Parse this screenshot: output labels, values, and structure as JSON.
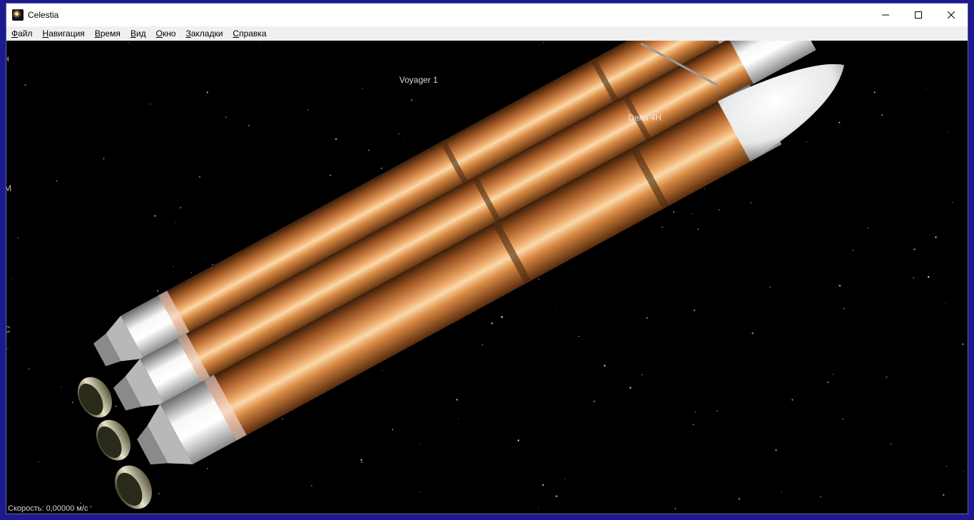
{
  "window": {
    "title": "Celestia",
    "controls": {
      "minimize": "minimize-icon",
      "maximize": "maximize-icon",
      "close": "close-icon"
    }
  },
  "menu": {
    "items": [
      {
        "first": "Ф",
        "rest": "айл"
      },
      {
        "first": "Н",
        "rest": "авигация"
      },
      {
        "first": "В",
        "rest": "ремя"
      },
      {
        "first": "В",
        "rest": "ид"
      },
      {
        "first": "О",
        "rest": "кно"
      },
      {
        "first": "З",
        "rest": "акладки"
      },
      {
        "first": "С",
        "rest": "правка"
      }
    ]
  },
  "scene": {
    "labels": {
      "voyager": "Voyager 1",
      "delta": "Delta 4H"
    },
    "edge_chars": [
      "н",
      "М",
      "С"
    ]
  },
  "status": {
    "velocity": "Скорость: 0,00000 м/с"
  },
  "colors": {
    "desktop": "#1b1b8e",
    "booster_orange": "#c8742c",
    "booster_white": "#f4f4f4",
    "space": "#000000"
  }
}
